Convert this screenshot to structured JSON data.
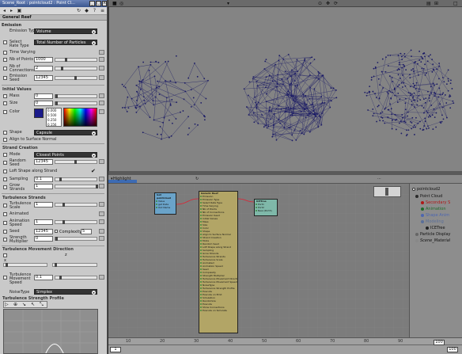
{
  "window": {
    "title": "Scene_Root : pointcloud2 : Point Cl..."
  },
  "property": {
    "main_tab": "General Reef",
    "emission": {
      "header": "Emission",
      "emission_type_label": "Emission Type",
      "emission_type_value": "Volume",
      "select_rate_label": "Select Rate Type",
      "select_rate_value": "Total Number of Particles",
      "time_varying_label": "Time Varying",
      "nb_points_label": "Nb of Points",
      "nb_points_value": "1000",
      "nb_connections_label": "Nb of Connections",
      "nb_connections_value": "2",
      "emission_seed_label": "Emission Seed",
      "emission_seed_value": "12345"
    },
    "initial_values": {
      "header": "Initial Values",
      "mass_label": "Mass",
      "mass_value": "0",
      "size_label": "Size",
      "size_value": "0",
      "color_label": "Color",
      "color_values": [
        "0.000",
        "0.500",
        "0.250",
        "0.156"
      ],
      "shape_label": "Shape",
      "shape_value": "Capsule",
      "align_label": "Align to Surface Normal"
    },
    "strand_creation": {
      "header": "Strand Creation",
      "mode_label": "Mode",
      "mode_value": "Closest Points",
      "random_seed_label": "Random Seed",
      "random_seed_value": "12345",
      "loft_label": "Loft Shape along Strand",
      "sampling_label": "Sampling",
      "sampling_value": "0.1",
      "grow_label": "Grow Strands",
      "grow_value": "1"
    },
    "turbulence": {
      "header": "Turbulence Strands",
      "scale_label": "Turbulence Scale",
      "scale_value": "1",
      "animated_label": "Animated",
      "anim_speed_label": "Animation Speed",
      "anim_speed_value": "1",
      "seed_label": "Seed",
      "seed_value": "12345",
      "complexity_label": "Complexity",
      "complexity_value": "5",
      "strength_label": "Strength Multiplier",
      "strength_value": "0"
    },
    "movement": {
      "header": "Turbulence Movement Direction",
      "x_label": "x",
      "z_label": "z",
      "x_value": "",
      "z_value": "",
      "speed_label": "Turbulence Movement Speed",
      "speed_value": "0.1",
      "noise_label": "NoiseType",
      "noise_value": "Simplex"
    },
    "profile": {
      "header": "Turbulence Strength Profile"
    }
  },
  "ice_tree": {
    "toolbar_label": "Highlight",
    "get_node": {
      "title": "Get pointcloud",
      "ports": [
        "Value",
        "get Data",
        "Out Name"
      ]
    },
    "compound": {
      "title": "Generic Reef",
      "ports": [
        "Emission",
        "Emission Type",
        "Select Rate Type",
        "Time Varying",
        "Nb of Points",
        "Nb of Connections",
        "Emission Seed",
        "Initial Values",
        "Mass",
        "Size",
        "Color",
        "Shape",
        "Align to Surface Normal",
        "Strand Creation",
        "Mode",
        "Random Seed",
        "Loft Shape along Strand",
        "Sampling",
        "Grow Strands",
        "Turbulence Strands",
        "Turbulence Scale",
        "Animated",
        "Animation Speed",
        "Seed",
        "Complexity",
        "Strength Multiplier",
        "Turbulence Movement Direction",
        "Turbulence Movement Speed",
        "NoiseType",
        "Turbulence Strength Profile",
        "Execute",
        "Execute on Emit",
        "Simulation",
        "Randomize",
        "Execute",
        "Show Connections",
        "Execute on Simulate"
      ]
    },
    "icetree_node": {
      "title": "ICETree",
      "ports": [
        "Port1",
        "Port2",
        "New (Port3)"
      ]
    }
  },
  "explorer": {
    "items": [
      "pointcloud2",
      "Point Cloud",
      "Secondary S",
      "Animation",
      "Shape Anim",
      "Modeling",
      "ICETree",
      "Particle Display",
      "Scene_Material"
    ]
  },
  "timeline": {
    "ticks": [
      "10",
      "20",
      "30",
      "40",
      "50",
      "60",
      "70",
      "80",
      "90"
    ],
    "start": "1",
    "end": "100",
    "end_b": "100"
  },
  "colors": {
    "panel_bg": "#c9c9c9",
    "viewport_bg": "#848484",
    "ice_bg": "#7c7c7c",
    "compound_node": "#b2a566",
    "get_node": "#6aa3c9",
    "icetree_node": "#7fb8a9",
    "point_color": "#1a1a66"
  }
}
